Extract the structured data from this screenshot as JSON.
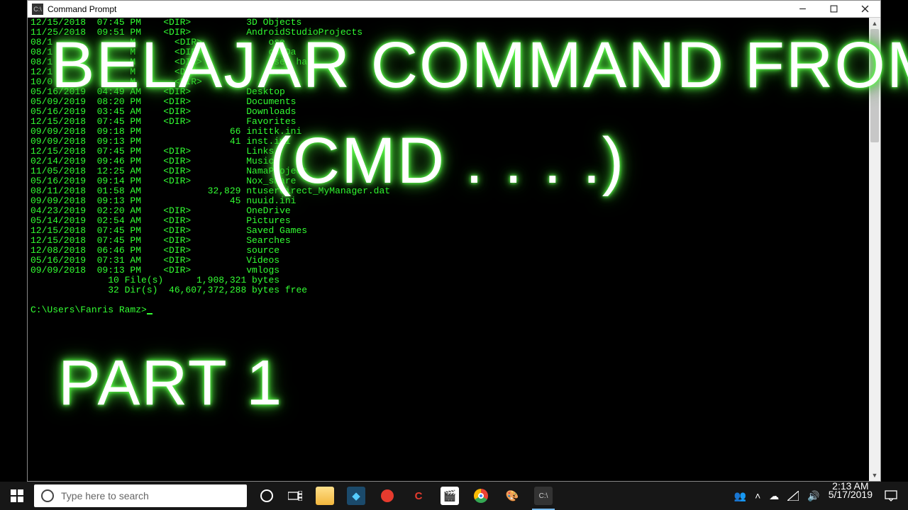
{
  "window": {
    "title": "Command Prompt"
  },
  "overlay": {
    "line1": "BELAJAR COMMAND FROMPT",
    "line2": "(CMD . . . .)",
    "line3": "PART 1"
  },
  "dir_listing": [
    {
      "date": "12/15/2018",
      "time": "07:45 PM",
      "dir": true,
      "size": "",
      "name": "3D Objects"
    },
    {
      "date": "11/25/2018",
      "time": "09:51 PM",
      "dir": true,
      "size": "",
      "name": "AndroidStudioProjects"
    },
    {
      "date": "08/1        ",
      "time": "    M",
      "dir": true,
      "size": "",
      "name": "  ose"
    },
    {
      "date": "08/1        ",
      "time": "    M",
      "dir": true,
      "size": "",
      "name": "  oseDa"
    },
    {
      "date": "08/1        ",
      "time": "    M",
      "dir": true,
      "size": "",
      "name": "  ose  har"
    },
    {
      "date": "12/1        ",
      "time": "    M",
      "dir": true,
      "size": "",
      "name": "  act"
    },
    {
      "date": "10/0        ",
      "time": "    M",
      "dir": true,
      "size": "",
      "name": ""
    },
    {
      "date": "05/16/2019",
      "time": "04:49 AM",
      "dir": true,
      "size": "",
      "name": "Desktop"
    },
    {
      "date": "05/09/2019",
      "time": "08:20 PM",
      "dir": true,
      "size": "",
      "name": "Documents"
    },
    {
      "date": "05/16/2019",
      "time": "03:45 AM",
      "dir": true,
      "size": "",
      "name": "Downloads"
    },
    {
      "date": "12/15/2018",
      "time": "07:45 PM",
      "dir": true,
      "size": "",
      "name": "Favorites"
    },
    {
      "date": "09/09/2018",
      "time": "09:18 PM",
      "dir": false,
      "size": "66",
      "name": "inittk.ini"
    },
    {
      "date": "09/09/2018",
      "time": "09:13 PM",
      "dir": false,
      "size": "41",
      "name": "inst.ini"
    },
    {
      "date": "12/15/2018",
      "time": "07:45 PM",
      "dir": true,
      "size": "",
      "name": "Links"
    },
    {
      "date": "02/14/2019",
      "time": "09:46 PM",
      "dir": true,
      "size": "",
      "name": "Music"
    },
    {
      "date": "11/05/2018",
      "time": "12:25 AM",
      "dir": true,
      "size": "",
      "name": "NamaProject"
    },
    {
      "date": "05/16/2019",
      "time": "09:14 PM",
      "dir": true,
      "size": "",
      "name": "Nox_share"
    },
    {
      "date": "08/11/2018",
      "time": "01:58 AM",
      "dir": false,
      "size": "32,829",
      "name": "ntuserdirect_MyManager.dat"
    },
    {
      "date": "09/09/2018",
      "time": "09:13 PM",
      "dir": false,
      "size": "45",
      "name": "nuuid.ini"
    },
    {
      "date": "04/23/2019",
      "time": "02:20 AM",
      "dir": true,
      "size": "",
      "name": "OneDrive"
    },
    {
      "date": "05/14/2019",
      "time": "02:54 AM",
      "dir": true,
      "size": "",
      "name": "Pictures"
    },
    {
      "date": "12/15/2018",
      "time": "07:45 PM",
      "dir": true,
      "size": "",
      "name": "Saved Games"
    },
    {
      "date": "12/15/2018",
      "time": "07:45 PM",
      "dir": true,
      "size": "",
      "name": "Searches"
    },
    {
      "date": "12/08/2018",
      "time": "06:46 PM",
      "dir": true,
      "size": "",
      "name": "source"
    },
    {
      "date": "05/16/2019",
      "time": "07:31 AM",
      "dir": true,
      "size": "",
      "name": "Videos"
    },
    {
      "date": "09/09/2018",
      "time": "09:13 PM",
      "dir": true,
      "size": "",
      "name": "vmlogs"
    }
  ],
  "summary": {
    "files_line": "              10 File(s)      1,908,321 bytes",
    "dirs_line": "              32 Dir(s)  46,607,372,288 bytes free"
  },
  "prompt": "C:\\Users\\Fanris Ramz>",
  "taskbar": {
    "search_placeholder": "Type here to search",
    "time": "2:13 AM",
    "date": "5/17/2019"
  }
}
